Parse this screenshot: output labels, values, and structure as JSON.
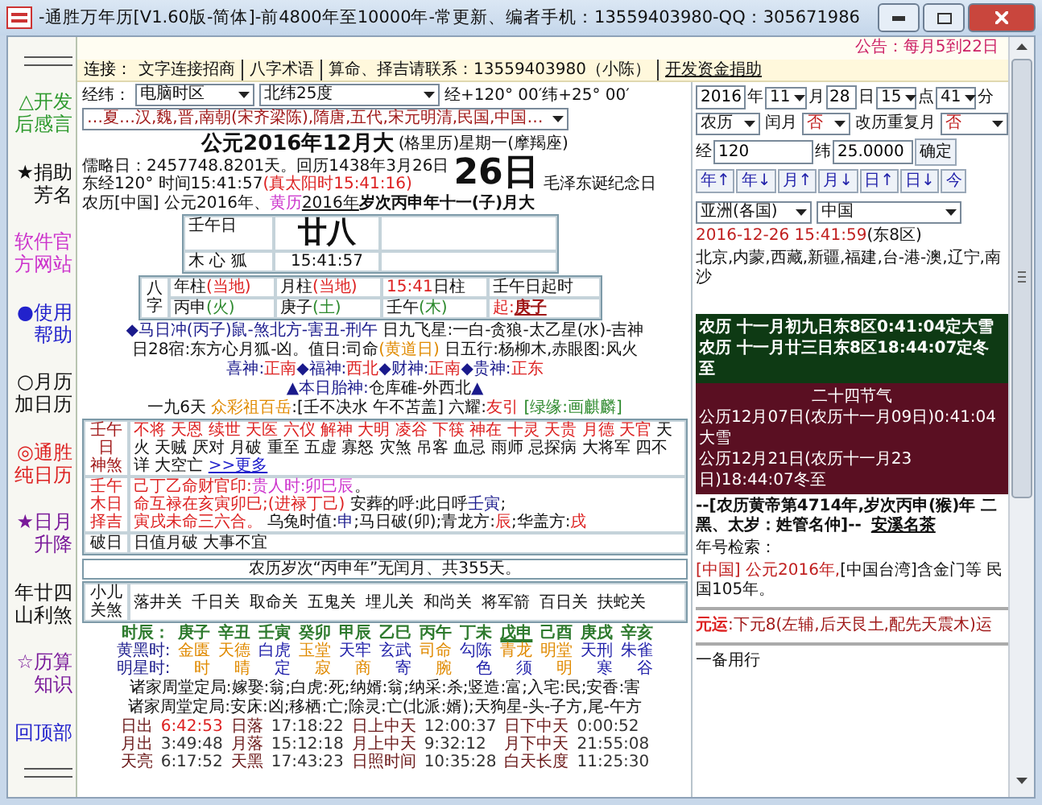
{
  "window": {
    "title": "-通胜万年历[V1.60版-简体]-前4800年至10000年-常更新、编者手机：13559403980-QQ：305671986"
  },
  "sidebar": {
    "items": [
      {
        "label": "△开发后感言",
        "color": "#2e9a2e"
      },
      {
        "label": "★捐助芳名",
        "color": "#111111"
      },
      {
        "label": "软件官方网站",
        "color": "#cc33cc"
      },
      {
        "label": "●使用帮助",
        "color": "#2222cc"
      },
      {
        "label": "○月历加日历",
        "color": "#111111"
      },
      {
        "label": "◎通胜纯日历",
        "color": "#dd2222"
      },
      {
        "label": "★日月升降",
        "color": "#7a1a9a"
      },
      {
        "label": "年廿四山利煞",
        "color": "#111111"
      },
      {
        "label": "☆历算知识",
        "color": "#7a1a9a"
      },
      {
        "label": "回顶部",
        "color": "#2222cc"
      }
    ]
  },
  "notice": "公告：每月5到22日",
  "link_bar": {
    "label": "连接：",
    "links": [
      "文字连接招商",
      "八字术语",
      "算命、择吉请联系：13559403980（小陈）",
      "开发资金捐助"
    ]
  },
  "location": {
    "label": "经纬：",
    "timezone": "电脑时区",
    "latitude": "北纬25度",
    "coords": "经+120° 00′纬+25° 00′",
    "dynasties": "…夏…汉,魏,晋,南朝(宋齐梁陈),隋唐,五代,宋元明清,民国,中国…"
  },
  "solar": {
    "heading": "公元2016年12月大",
    "heading_note": "(格里历)星期一(摩羯座)",
    "julian": "儒略日：2457748.8201天。回历1438年3月26日",
    "time": "东经120° 时间15:41:57",
    "true_solar": "(真太阳时15:41:16)",
    "day": "26日",
    "festival": "毛泽东诞纪念日"
  },
  "lunar_line": {
    "prefix": "农历[中国] 公元2016年、",
    "calendar": "黄历",
    "year": "2016年",
    "suffix": "岁次丙申年十一(子)月大"
  },
  "lunar_day": {
    "ganzhi_day": "壬午日",
    "star": "木 心 狐",
    "day": "廿八",
    "time": "15:41:57"
  },
  "bazi": {
    "label": "八字",
    "headers": [
      {
        "main": "年柱",
        "note": "(当地)"
      },
      {
        "main": "月柱",
        "note": "(当地)"
      },
      {
        "main": "日柱",
        "note": "15:41"
      },
      {
        "main": "壬午日起时"
      }
    ],
    "pillars": [
      {
        "main": "丙申",
        "note": "(火)"
      },
      {
        "main": "庚子",
        "note": "(土)"
      },
      {
        "main": "壬午",
        "note": "(木)"
      },
      {
        "main": "起:",
        "note": "庚子"
      }
    ]
  },
  "info_lines": [
    [
      {
        "text": "◆马日冲(丙子)鼠-煞北方-害丑-刑午",
        "kind": "term"
      },
      {
        "text": " 日九飞星:一白-贪狼-太乙星(水)-吉神",
        "kind": "plain"
      }
    ],
    [
      {
        "text": "日28宿:东方心月狐-凶。值日:司命",
        "kind": "plain"
      },
      {
        "text": "(黄道日)",
        "kind": "highlight"
      },
      {
        "text": " 日五行:杨柳木,赤眼图:风火",
        "kind": "plain"
      }
    ],
    [
      {
        "text": "喜神:",
        "kind": "term"
      },
      {
        "text": "正南",
        "kind": "value"
      },
      {
        "text": "◆福神:",
        "kind": "term"
      },
      {
        "text": "西北",
        "kind": "value"
      },
      {
        "text": "◆财神:",
        "kind": "term"
      },
      {
        "text": "正南",
        "kind": "value"
      },
      {
        "text": "◆贵神:",
        "kind": "term"
      },
      {
        "text": "正东",
        "kind": "value"
      }
    ],
    [
      {
        "text": "▲本日胎神:",
        "kind": "term"
      },
      {
        "text": "仓库碓-外西北",
        "kind": "plain"
      },
      {
        "text": "▲",
        "kind": "term"
      }
    ],
    [
      {
        "text": "一九6天 ",
        "kind": "plain"
      },
      {
        "text": "众彩祖百岳",
        "kind": "highlight"
      },
      {
        "text": ":[壬不决水 午不苫盖] 六耀:",
        "kind": "plain"
      },
      {
        "text": "友引",
        "kind": "value"
      },
      {
        "text": " [绿缘:画麒麟]",
        "kind": "note"
      }
    ]
  ],
  "shensha": {
    "label": [
      "壬午",
      "日",
      "神煞"
    ],
    "items": [
      {
        "text": "不将",
        "kind": "good"
      },
      {
        "text": "天恩",
        "kind": "good"
      },
      {
        "text": "续世",
        "kind": "good"
      },
      {
        "text": "天医",
        "kind": "good"
      },
      {
        "text": "六仪",
        "kind": "good"
      },
      {
        "text": "解神",
        "kind": "good"
      },
      {
        "text": "大明",
        "kind": "good"
      },
      {
        "text": "凌谷",
        "kind": "good"
      },
      {
        "text": "下筷",
        "kind": "good"
      },
      {
        "text": "神在",
        "kind": "good"
      },
      {
        "text": "十灵",
        "kind": "good"
      },
      {
        "text": "天贵",
        "kind": "good"
      },
      {
        "text": "月德",
        "kind": "good"
      },
      {
        "text": "天官",
        "kind": "good"
      },
      {
        "text": "天火",
        "kind": "bad"
      },
      {
        "text": "天贼",
        "kind": "bad"
      },
      {
        "text": "厌对",
        "kind": "bad"
      },
      {
        "text": "月破",
        "kind": "bad"
      },
      {
        "text": "重至",
        "kind": "bad"
      },
      {
        "text": "五虚",
        "kind": "bad"
      },
      {
        "text": "寡怒",
        "kind": "bad"
      },
      {
        "text": "灾煞",
        "kind": "bad"
      },
      {
        "text": "吊客",
        "kind": "bad"
      },
      {
        "text": "血忌",
        "kind": "bad"
      },
      {
        "text": "雨师",
        "kind": "bad"
      },
      {
        "text": "忌探病",
        "kind": "bad"
      },
      {
        "text": "大将军",
        "kind": "bad"
      },
      {
        "text": "四不详",
        "kind": "bad"
      },
      {
        "text": "大空亡",
        "kind": "bad"
      }
    ],
    "more": ">>更多"
  },
  "zeji": {
    "label": [
      "壬午",
      "木日",
      "择吉"
    ],
    "lines": [
      [
        {
          "text": "己丁乙命财官印:",
          "kind": "value"
        },
        {
          "text": "贵人时:卯巳辰",
          "kind": "accent"
        },
        {
          "text": "。",
          "kind": "plain"
        }
      ],
      [
        {
          "text": "命互禄在亥寅卯巳;(进禄丁己)",
          "kind": "value"
        },
        {
          "text": " 安葬的呼:此日呼",
          "kind": "plain"
        },
        {
          "text": "壬寅",
          "kind": "term"
        },
        {
          "text": ";",
          "kind": "plain"
        }
      ],
      [
        {
          "text": "寅戌未命三六合。",
          "kind": "value"
        },
        {
          "text": " 乌兔时值:",
          "kind": "plain"
        },
        {
          "text": "申",
          "kind": "term"
        },
        {
          "text": ";马日破(卯);青龙方:",
          "kind": "plain"
        },
        {
          "text": "辰",
          "kind": "value"
        },
        {
          "text": ";华盖方:",
          "kind": "plain"
        },
        {
          "text": "戌",
          "kind": "value"
        }
      ]
    ]
  },
  "po_ri": {
    "label": "破日",
    "text": "日值月破 大事不宜"
  },
  "year_note": "农历岁次“丙申年”无闰月、共355天。",
  "child": {
    "label": "小儿关煞",
    "items": [
      "落井关",
      "千日关",
      "取命关",
      "五鬼关",
      "埋儿关",
      "和尚关",
      "将军箭",
      "百日关",
      "扶蛇关"
    ]
  },
  "hours": {
    "label": "时辰：",
    "items": [
      {
        "text": "庚子",
        "selected": false
      },
      {
        "text": "辛丑",
        "selected": false
      },
      {
        "text": "壬寅",
        "selected": false
      },
      {
        "text": "癸卯",
        "selected": false
      },
      {
        "text": "甲辰",
        "selected": false
      },
      {
        "text": "乙巳",
        "selected": false
      },
      {
        "text": "丙午",
        "selected": false
      },
      {
        "text": "丁未",
        "selected": false
      },
      {
        "text": "戊申",
        "selected": true
      },
      {
        "text": "己酉",
        "selected": false
      },
      {
        "text": "庚戌",
        "selected": false
      },
      {
        "text": "辛亥",
        "selected": false
      }
    ]
  },
  "yellow_black": {
    "label": "黄黑时:",
    "items": [
      {
        "text": "金匮",
        "kind": "lucky"
      },
      {
        "text": "天德",
        "kind": "lucky"
      },
      {
        "text": "白虎",
        "kind": "unlucky"
      },
      {
        "text": "玉堂",
        "kind": "lucky"
      },
      {
        "text": "天牢",
        "kind": "unlucky"
      },
      {
        "text": "玄武",
        "kind": "unlucky"
      },
      {
        "text": "司命",
        "kind": "lucky"
      },
      {
        "text": "勾陈",
        "kind": "unlucky"
      },
      {
        "text": "青龙",
        "kind": "lucky"
      },
      {
        "text": "明堂",
        "kind": "lucky"
      },
      {
        "text": "天刑",
        "kind": "unlucky"
      },
      {
        "text": "朱雀",
        "kind": "unlucky"
      }
    ]
  },
  "star_hours": {
    "label": "明星时:",
    "items": [
      {
        "text": "时",
        "kind": "lucky"
      },
      {
        "text": "晴",
        "kind": "lucky"
      },
      {
        "text": "定",
        "kind": "unlucky"
      },
      {
        "text": "寂",
        "kind": "lucky"
      },
      {
        "text": "商",
        "kind": "lucky"
      },
      {
        "text": "寄",
        "kind": "unlucky"
      },
      {
        "text": "腕",
        "kind": "lucky"
      },
      {
        "text": "色",
        "kind": "unlucky"
      },
      {
        "text": "须",
        "kind": "unlucky"
      },
      {
        "text": "明",
        "kind": "lucky"
      },
      {
        "text": "寒",
        "kind": "unlucky"
      },
      {
        "text": "谷",
        "kind": "unlucky"
      }
    ]
  },
  "zhoutang": [
    "诸家周堂定局:嫁娶:翁;白虎:死;纳婿:翁;纳采:杀;竖造:富;入宅:民;安香:害",
    "诸家周堂定局:安床:凶;移栖:亡;除灵:亡(北派:婿);天狗星-头-子方,尾-午方"
  ],
  "sun_moon": [
    [
      {
        "label": "日出",
        "value": "6:42:53",
        "highlighted": true
      },
      {
        "label": "日落",
        "value": "17:18:22",
        "highlighted": false
      },
      {
        "label": "日上中天",
        "value": "12:00:37",
        "highlighted": false
      },
      {
        "label": "日下中天",
        "value": "0:00:52",
        "highlighted": false
      }
    ],
    [
      {
        "label": "月出",
        "value": "3:49:48",
        "highlighted": false
      },
      {
        "label": "月落",
        "value": "15:12:18",
        "highlighted": false
      },
      {
        "label": "月上中天",
        "value": "9:32:12",
        "highlighted": false
      },
      {
        "label": "月下中天",
        "value": "21:55:08",
        "highlighted": false
      }
    ],
    [
      {
        "label": "天亮",
        "value": "6:17:52",
        "highlighted": false
      },
      {
        "label": "天黑",
        "value": "17:43:23",
        "highlighted": false
      },
      {
        "label": "日照时间",
        "value": "10:35:28",
        "highlighted": false
      },
      {
        "label": "白天长度",
        "value": "11:25:30",
        "highlighted": false
      }
    ]
  ],
  "date_form": {
    "year": "2016",
    "year_label": "年",
    "month": "11",
    "month_label": "月",
    "day": "28",
    "day_label": "日",
    "hour": "15",
    "hour_label": "点",
    "minute": "41",
    "minute_label": "分",
    "calendar": "农历",
    "leap_label": "闰月",
    "leap": "否",
    "repeat_label": "改历重复月",
    "repeat": "否",
    "lon_label": "经",
    "lon": "120",
    "lat_label": "纬",
    "lat": "25.0000",
    "ok": "确定"
  },
  "nav_buttons": [
    "年↑",
    "年↓",
    "月↑",
    "月↓",
    "日↑",
    "日↓",
    "今"
  ],
  "region": {
    "continent": "亚洲(各国)",
    "country": "中国"
  },
  "local_time": {
    "datetime": "2016-12-26 15:41:59",
    "zone": "(东8区)"
  },
  "areas": "北京,内蒙,西藏,新疆,福建,台-港-澳,辽宁,南沙",
  "jieqi_lunar": [
    "农历 十一月初九日东8区0:41:04定大雪",
    "农历 十一月廿三日东8区18:44:07定冬至"
  ],
  "jieqi": {
    "title": "二十四节气",
    "lines": [
      "公历12月07日(农历十一月09日)0:41:04大雪",
      "公历12月21日(农历十一月23日)18:44:07冬至"
    ]
  },
  "huangdi": {
    "text": "--[农历黄帝第4714年,岁次丙申(猴)年 二黑、太岁：姓管名仲]--",
    "link": "安溪名茶"
  },
  "era": {
    "title": "年号检索：",
    "cn": "[中国] 公元2016年,",
    "tw": "[中国台湾]含金门等 民国105年。"
  },
  "yuanyun": {
    "label": "元运",
    "text": ":下元8(左辅,后天艮土,配先天震木)运"
  },
  "backup": "一备用行"
}
